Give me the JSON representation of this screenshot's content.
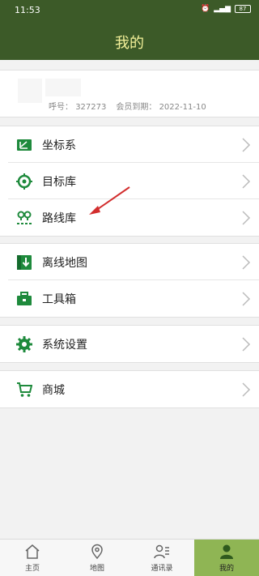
{
  "status": {
    "time": "11:53",
    "battery": "87"
  },
  "header": {
    "title": "我的"
  },
  "profile": {
    "number_label": "呼号：",
    "number_value": "327273",
    "expiry_label": "会员到期：",
    "expiry_value": "2022-11-10"
  },
  "menu": {
    "group1": [
      {
        "label": "坐标系",
        "icon": "coordinate-icon"
      },
      {
        "label": "目标库",
        "icon": "target-icon"
      },
      {
        "label": "路线库",
        "icon": "route-icon"
      }
    ],
    "group2": [
      {
        "label": "离线地图",
        "icon": "offline-map-icon"
      },
      {
        "label": "工具箱",
        "icon": "toolbox-icon"
      }
    ],
    "group3": [
      {
        "label": "系统设置",
        "icon": "gear-icon"
      }
    ],
    "group4": [
      {
        "label": "商城",
        "icon": "cart-icon"
      }
    ]
  },
  "tabs": [
    {
      "label": "主页",
      "icon": "home-icon"
    },
    {
      "label": "地图",
      "icon": "map-pin-icon"
    },
    {
      "label": "通讯录",
      "icon": "contacts-icon"
    },
    {
      "label": "我的",
      "icon": "person-icon",
      "active": true
    }
  ],
  "colors": {
    "header": "#3c5a28",
    "title": "#f4f19a",
    "icon_green": "#1e8a3c",
    "tab_active": "#8fb554",
    "arrow": "#d22d2d"
  }
}
